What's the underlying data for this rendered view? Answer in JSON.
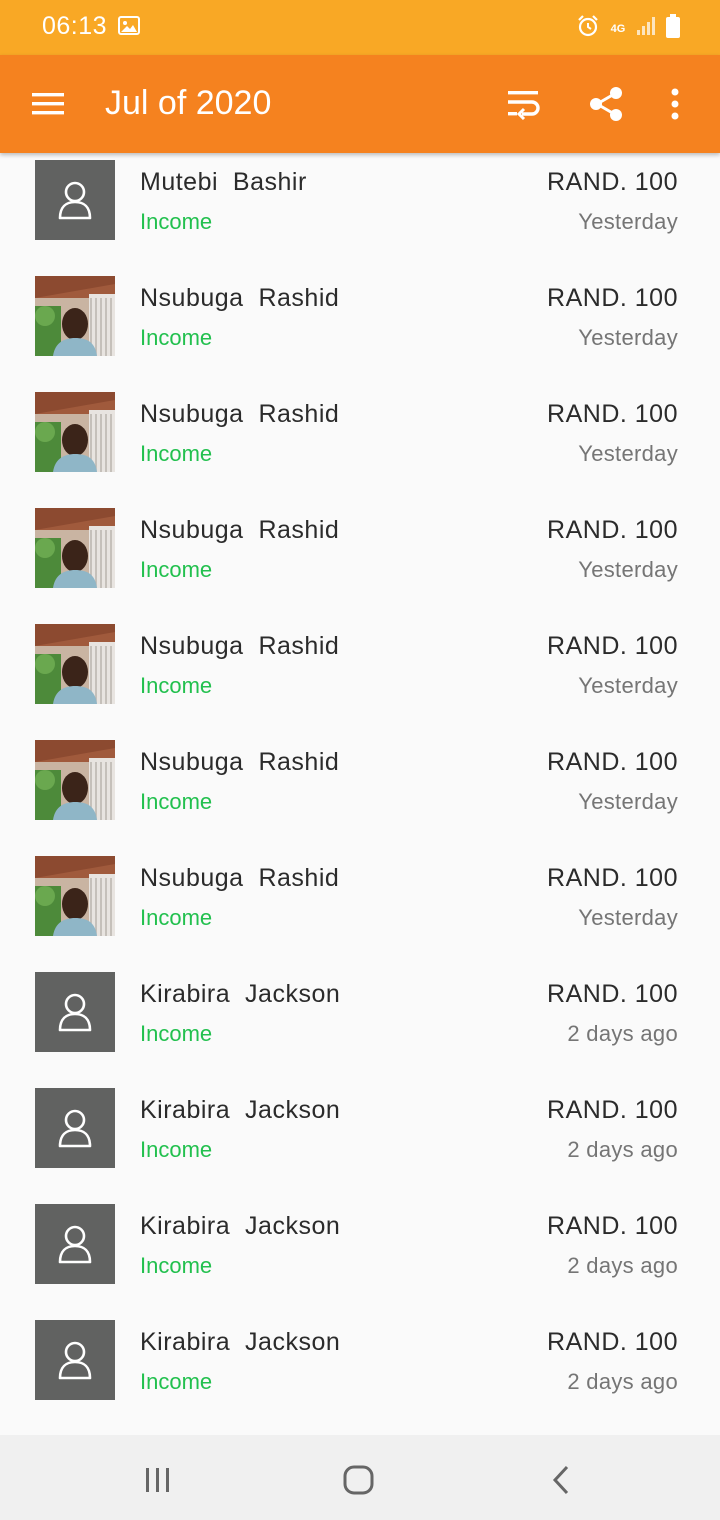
{
  "status_bar": {
    "time": "06:13",
    "network": "4G",
    "icons": [
      "gallery-icon",
      "alarm-icon",
      "signal-icon",
      "battery-icon"
    ]
  },
  "app_bar": {
    "title": "Jul of 2020",
    "background": "#f5821f",
    "icons": [
      "menu-icon",
      "sort-icon",
      "share-icon",
      "more-vert-icon"
    ]
  },
  "transactions": [
    {
      "name": "Mutebi  Bashir",
      "type": "Income",
      "amount": "RAND. 100",
      "date": "Yesterday",
      "avatar": "placeholder"
    },
    {
      "name": "Nsubuga  Rashid",
      "type": "Income",
      "amount": "RAND. 100",
      "date": "Yesterday",
      "avatar": "photo"
    },
    {
      "name": "Nsubuga  Rashid",
      "type": "Income",
      "amount": "RAND. 100",
      "date": "Yesterday",
      "avatar": "photo"
    },
    {
      "name": "Nsubuga  Rashid",
      "type": "Income",
      "amount": "RAND. 100",
      "date": "Yesterday",
      "avatar": "photo"
    },
    {
      "name": "Nsubuga  Rashid",
      "type": "Income",
      "amount": "RAND. 100",
      "date": "Yesterday",
      "avatar": "photo"
    },
    {
      "name": "Nsubuga  Rashid",
      "type": "Income",
      "amount": "RAND. 100",
      "date": "Yesterday",
      "avatar": "photo"
    },
    {
      "name": "Nsubuga  Rashid",
      "type": "Income",
      "amount": "RAND. 100",
      "date": "Yesterday",
      "avatar": "photo"
    },
    {
      "name": "Kirabira  Jackson",
      "type": "Income",
      "amount": "RAND. 100",
      "date": "2 days ago",
      "avatar": "placeholder"
    },
    {
      "name": "Kirabira  Jackson",
      "type": "Income",
      "amount": "RAND. 100",
      "date": "2 days ago",
      "avatar": "placeholder"
    },
    {
      "name": "Kirabira  Jackson",
      "type": "Income",
      "amount": "RAND. 100",
      "date": "2 days ago",
      "avatar": "placeholder"
    },
    {
      "name": "Kirabira  Jackson",
      "type": "Income",
      "amount": "RAND. 100",
      "date": "2 days ago",
      "avatar": "placeholder"
    }
  ],
  "colors": {
    "status_bar": "#f9a825",
    "income": "#22c04e",
    "avatar_placeholder": "#616261"
  },
  "nav_bar": {
    "icons": [
      "recents-icon",
      "home-icon",
      "back-icon"
    ]
  }
}
